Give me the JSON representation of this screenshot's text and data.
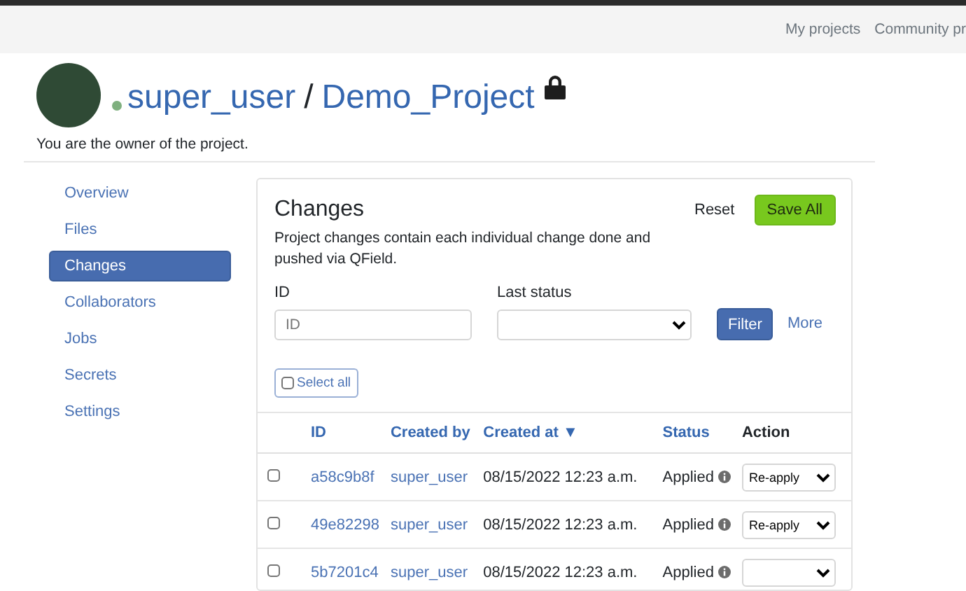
{
  "navbar": {
    "links": [
      "My projects",
      "Community pr"
    ]
  },
  "header": {
    "owner": "super_user",
    "separator": "/",
    "project": "Demo_Project",
    "note": "You are the owner of the project."
  },
  "sidebar": {
    "items": [
      {
        "label": "Overview",
        "selected": false
      },
      {
        "label": "Files",
        "selected": false
      },
      {
        "label": "Changes",
        "selected": true
      },
      {
        "label": "Collaborators",
        "selected": false
      },
      {
        "label": "Jobs",
        "selected": false
      },
      {
        "label": "Secrets",
        "selected": false
      },
      {
        "label": "Settings",
        "selected": false
      }
    ]
  },
  "changes": {
    "title": "Changes",
    "description": "Project changes contain each individual change done and pushed via QField.",
    "reset": "Reset",
    "save_all": "Save All",
    "filters": {
      "id_label": "ID",
      "id_placeholder": "ID",
      "status_label": "Last status",
      "filter": "Filter",
      "more": "More"
    },
    "select_all": {
      "label": "Select all",
      "checked": false
    },
    "table": {
      "columns": [
        {
          "label": "ID",
          "kind": "link"
        },
        {
          "label": "Created by",
          "kind": "link"
        },
        {
          "label": "Created at",
          "kind": "link",
          "sort": "▼"
        },
        {
          "label": "Status",
          "kind": "link"
        },
        {
          "label": "Action",
          "kind": "plain"
        }
      ],
      "rows": [
        {
          "checked": false,
          "id": "a58c9b8f",
          "created_by": "super_user",
          "created_at": "08/15/2022 12:23 a.m.",
          "status": "Applied",
          "action": "Re-apply"
        },
        {
          "checked": false,
          "id": "49e82298",
          "created_by": "super_user",
          "created_at": "08/15/2022 12:23 a.m.",
          "status": "Applied",
          "action": "Re-apply"
        },
        {
          "checked": false,
          "id": "5b7201c4",
          "created_by": "super_user",
          "created_at": "08/15/2022 12:23 a.m.",
          "status": "Applied"
        }
      ]
    }
  }
}
